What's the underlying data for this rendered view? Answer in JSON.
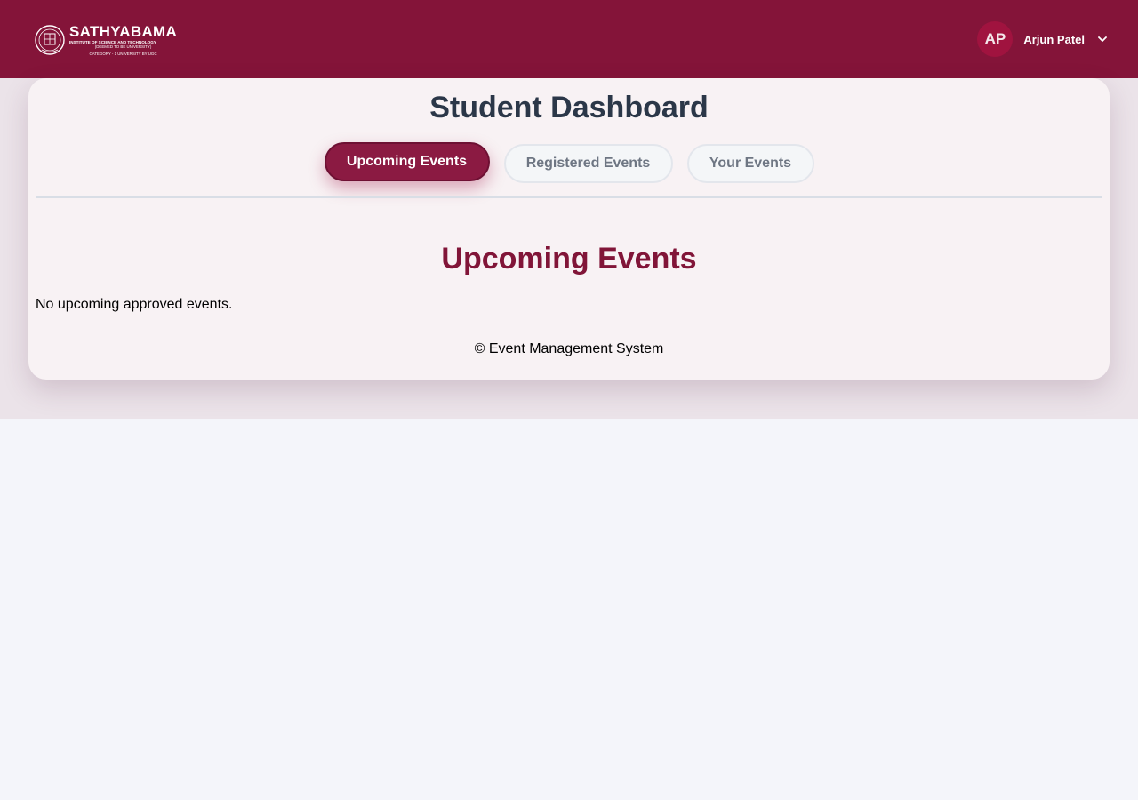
{
  "header": {
    "logo": {
      "name": "SATHYABAMA",
      "line1": "INSTITUTE OF SCIENCE AND TECHNOLOGY",
      "line2": "(DEEMED TO BE UNIVERSITY)",
      "line3": "CATEGORY - 1 UNIVERSITY BY UGC"
    },
    "user": {
      "initials": "AP",
      "name": "Arjun Patel",
      "menu_icon": "chevron-down-icon"
    },
    "colors": {
      "bar": "#841439",
      "avatar": "#a0133f"
    }
  },
  "dashboard": {
    "title": "Student Dashboard",
    "tabs": [
      {
        "label": "Upcoming Events",
        "active": true
      },
      {
        "label": "Registered Events",
        "active": false
      },
      {
        "label": "Your Events",
        "active": false
      }
    ],
    "section_title": "Upcoming Events",
    "empty_message": "No upcoming approved events.",
    "footer": "© Event Management System",
    "colors": {
      "accent": "#8b1a42",
      "title": "#2b3748",
      "section_title": "#811538"
    }
  }
}
